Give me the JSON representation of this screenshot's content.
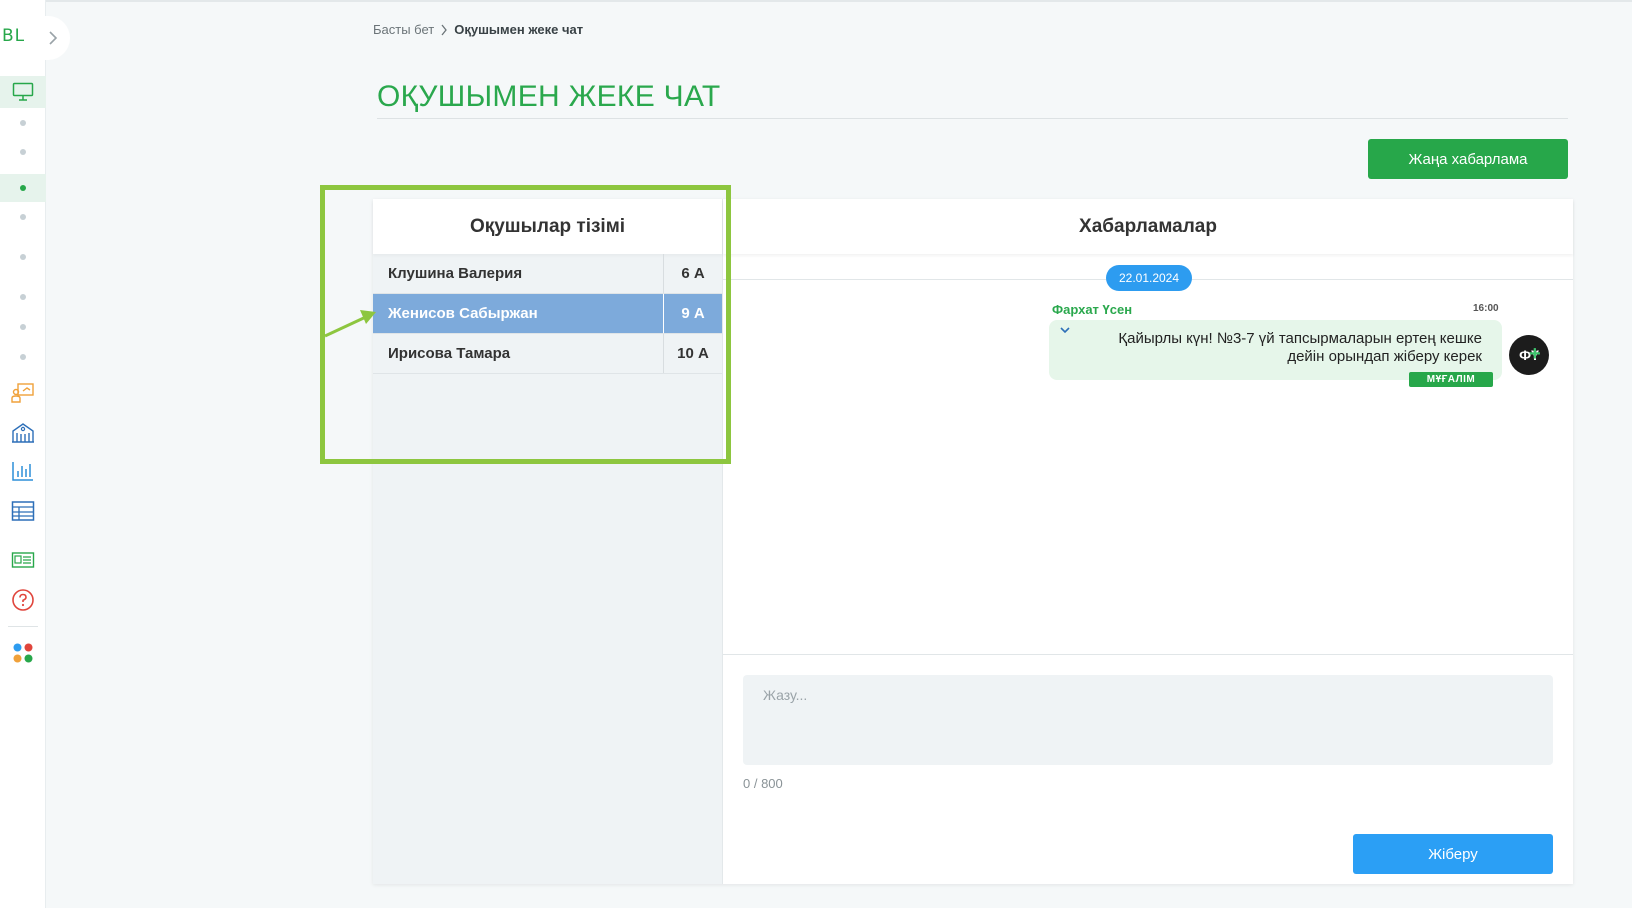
{
  "sidebar": {
    "logo": "BL",
    "nav_icons": [
      "monitor-icon",
      "dot",
      "dot",
      "dot",
      "dot",
      "dot",
      "dot",
      "dot",
      "dot",
      "presentation-icon",
      "school-icon",
      "bar-chart-icon",
      "table-icon",
      "card-icon",
      "help-icon",
      "apps-icon"
    ],
    "colors": {
      "green": "#27a74a",
      "orange": "#f0a13a",
      "blue": "#2d6fb8",
      "red": "#e0453c"
    }
  },
  "breadcrumb": {
    "home": "Басты бет",
    "current": "Оқушымен жеке чат"
  },
  "page": {
    "title": "ОҚУШЫМЕН ЖЕКЕ ЧАТ",
    "new_message_label": "Жаңа хабарлама"
  },
  "students": {
    "title": "Оқушылар тізімі",
    "rows": [
      {
        "name": "Клушина Валерия",
        "class": "6 А",
        "selected": false
      },
      {
        "name": "Женисов Сабыржан",
        "class": "9 А",
        "selected": true
      },
      {
        "name": "Ирисова Тамара",
        "class": "10 А",
        "selected": false
      }
    ]
  },
  "messages": {
    "title": "Хабарламалар",
    "date": "22.01.2024",
    "items": [
      {
        "sender": "Фархат Үсен",
        "time": "16:00",
        "text_line1": "Қайырлы күн! №3-7 үй тапсырмаларын ертең кешке",
        "text_line2": "дейін орындап жіберу керек",
        "role": "МҰҒАЛІМ",
        "avatar_initials": "ФҮ"
      }
    ]
  },
  "compose": {
    "placeholder": "Жазу...",
    "counter": "0 / 800",
    "send_label": "Жіберу"
  },
  "annotation": {
    "highlight_color": "#8dc63f"
  }
}
